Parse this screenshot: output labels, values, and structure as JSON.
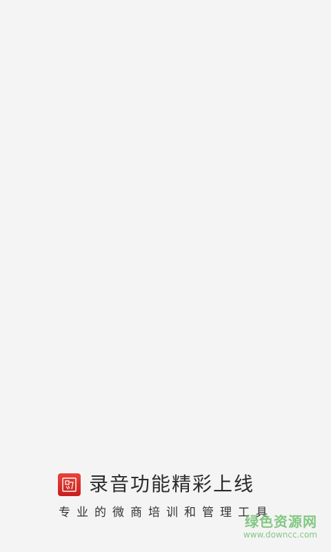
{
  "splash": {
    "logo_icon": "app-logo-icon",
    "headline": "录音功能精彩上线",
    "subline": "专业的微商培训和管理工具"
  },
  "watermark": {
    "site_name": "绿色资源网",
    "site_url": "www.downcc.com"
  },
  "colors": {
    "background": "#f4f4f4",
    "logo_red": "#d42a26",
    "text": "#2b2b2b",
    "watermark_green": "#5cb85c"
  }
}
